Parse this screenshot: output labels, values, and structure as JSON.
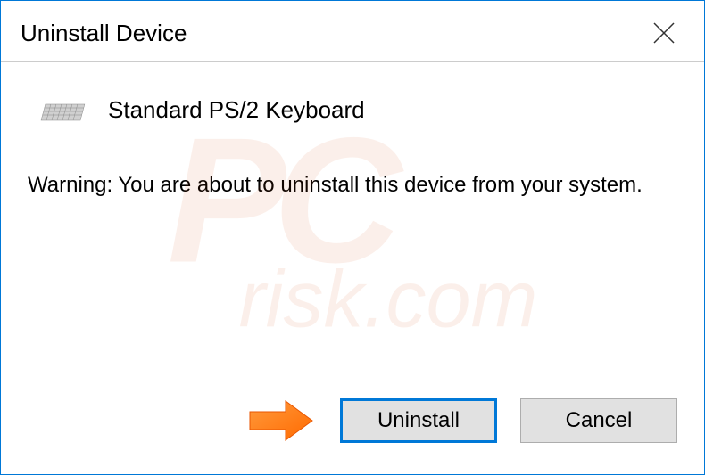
{
  "dialog": {
    "title": "Uninstall Device",
    "device_name": "Standard PS/2 Keyboard",
    "warning_message": "Warning: You are about to uninstall this device from your system.",
    "buttons": {
      "primary": "Uninstall",
      "secondary": "Cancel"
    }
  },
  "watermark": {
    "line1": "PC",
    "line2": "risk.com"
  }
}
